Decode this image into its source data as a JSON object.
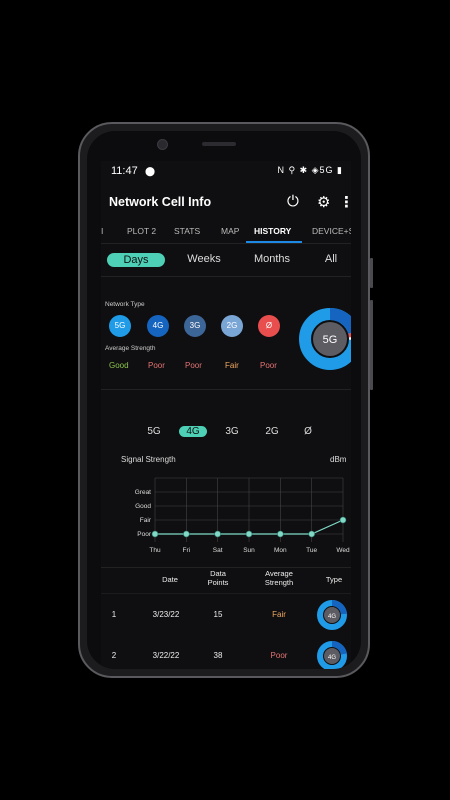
{
  "statusbar": {
    "time": "11:47",
    "right_icons": "N ⚲ ✱ ◈5G ▮"
  },
  "appbar": {
    "title": "Network Cell Info"
  },
  "tabs": [
    {
      "label": "I"
    },
    {
      "label": "PLOT 2"
    },
    {
      "label": "STATS"
    },
    {
      "label": "MAP"
    },
    {
      "label": "HISTORY"
    },
    {
      "label": "DEVICE+SIM"
    }
  ],
  "range": [
    {
      "label": "Days"
    },
    {
      "label": "Weeks"
    },
    {
      "label": "Months"
    },
    {
      "label": "All"
    }
  ],
  "summary": {
    "network_type_label": "Network Type",
    "avg_strength_label": "Average Strength",
    "types": [
      {
        "label": "5G",
        "color": "#1f9be8"
      },
      {
        "label": "4G",
        "color": "#1565c0"
      },
      {
        "label": "3G",
        "color": "#3c6598"
      },
      {
        "label": "2G",
        "color": "#7aa6d6"
      },
      {
        "label": "Ø",
        "color": "#e94e4e"
      }
    ],
    "strengths": [
      {
        "label": "Good",
        "color": "#8bc34a"
      },
      {
        "label": "Poor",
        "color": "#e57373"
      },
      {
        "label": "Poor",
        "color": "#e57373"
      },
      {
        "label": "Fair",
        "color": "#f0a860"
      },
      {
        "label": "Poor",
        "color": "#e57373"
      }
    ],
    "donut_label": "5G"
  },
  "filters": [
    {
      "label": "5G"
    },
    {
      "label": "4G"
    },
    {
      "label": "3G"
    },
    {
      "label": "2G"
    },
    {
      "label": "Ø"
    }
  ],
  "chart_data": {
    "type": "line",
    "title": "Signal Strength",
    "unit_label": "dBm",
    "categories": [
      "Thu",
      "Fri",
      "Sat",
      "Sun",
      "Mon",
      "Tue",
      "Wed"
    ],
    "y_levels": [
      "Poor",
      "Fair",
      "Good",
      "Great"
    ],
    "values": [
      0,
      0,
      0,
      0,
      0,
      0,
      1
    ],
    "grid": true
  },
  "table": {
    "headers": [
      "Date",
      "Data\nPoints",
      "Average\nStrength",
      "Type"
    ],
    "rows": [
      {
        "index": "1",
        "date": "3/23/22",
        "points": "15",
        "strength": "Fair",
        "strength_color": "#f0a860",
        "type": "4G"
      },
      {
        "index": "2",
        "date": "3/22/22",
        "points": "38",
        "strength": "Poor",
        "strength_color": "#e57373",
        "type": "4G"
      }
    ]
  }
}
